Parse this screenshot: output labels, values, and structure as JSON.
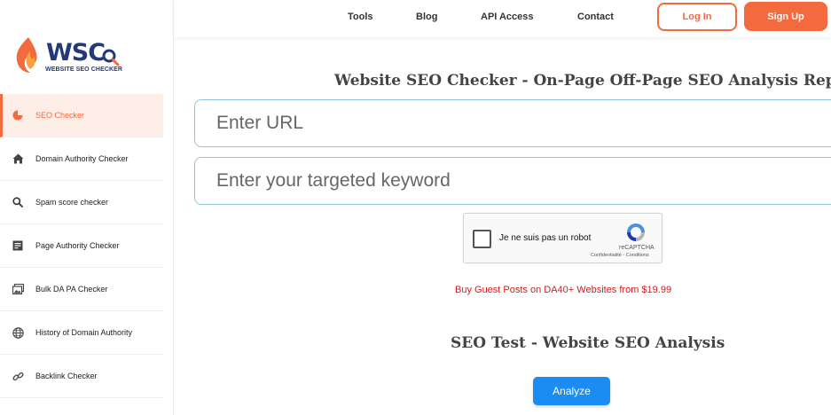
{
  "logo": {
    "text": "WSC",
    "tagline": "WEBSITE SEO CHECKER"
  },
  "topnav": {
    "tools": "Tools",
    "blog": "Blog",
    "api": "API Access",
    "contact": "Contact",
    "login": "Log In",
    "signup": "Sign Up"
  },
  "sidebar": {
    "items": [
      {
        "label": "SEO Checker",
        "icon": "pie-chart-icon",
        "active": true
      },
      {
        "label": "Domain Authority Checker",
        "icon": "home-icon"
      },
      {
        "label": "Spam score checker",
        "icon": "search-icon"
      },
      {
        "label": "Page Authority Checker",
        "icon": "document-icon"
      },
      {
        "label": "Bulk DA PA Checker",
        "icon": "image-stack-icon"
      },
      {
        "label": "History of Domain Authority",
        "icon": "globe-icon"
      },
      {
        "label": "Backlink Checker",
        "icon": "link-icon"
      }
    ]
  },
  "main": {
    "title": "Website SEO Checker - On-Page Off-Page SEO Analysis Report",
    "url_placeholder": "Enter URL",
    "keyword_placeholder": "Enter your targeted keyword",
    "captcha": {
      "label": "Je ne suis pas un robot",
      "brand": "reCAPTCHA",
      "links": "Confidentialité - Conditions"
    },
    "promo": "Buy Guest Posts on DA40+ Websites from $19.99",
    "section_title": "SEO Test - Website SEO Analysis",
    "analyze": "Analyze"
  },
  "colors": {
    "accent": "#f26a3d",
    "primary_button": "#1a8cf2",
    "promo": "#d11c1c",
    "brand_blue": "#233a7a"
  }
}
